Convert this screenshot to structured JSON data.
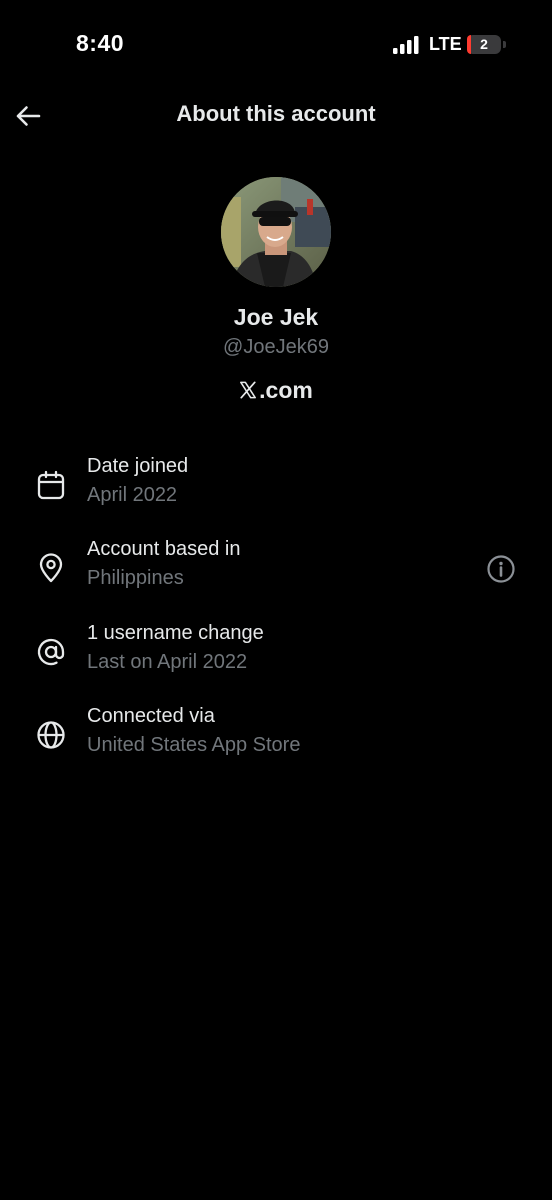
{
  "status_bar": {
    "time": "8:40",
    "network": "LTE",
    "battery_label": "2",
    "battery_level_percent": 2
  },
  "header": {
    "title": "About this account",
    "back_icon": "arrow-left-icon"
  },
  "profile": {
    "display_name": "Joe Jek",
    "handle": "@JoeJek69",
    "site": ".com",
    "site_logo": "x-logo-icon"
  },
  "info_rows": [
    {
      "icon": "calendar-icon",
      "title": "Date joined",
      "subtitle": "April 2022"
    },
    {
      "icon": "location-pin-icon",
      "title": "Account based in",
      "subtitle": "Philippines",
      "trailing_icon": "info-circle-icon"
    },
    {
      "icon": "at-sign-icon",
      "title": "1 username change",
      "subtitle": "Last on April 2022"
    },
    {
      "icon": "globe-icon",
      "title": "Connected via",
      "subtitle": "United States App Store"
    }
  ],
  "colors": {
    "background": "#000000",
    "primary_text": "#e7e9ea",
    "secondary_text": "#71767b",
    "battery_low": "#ff3b30"
  }
}
